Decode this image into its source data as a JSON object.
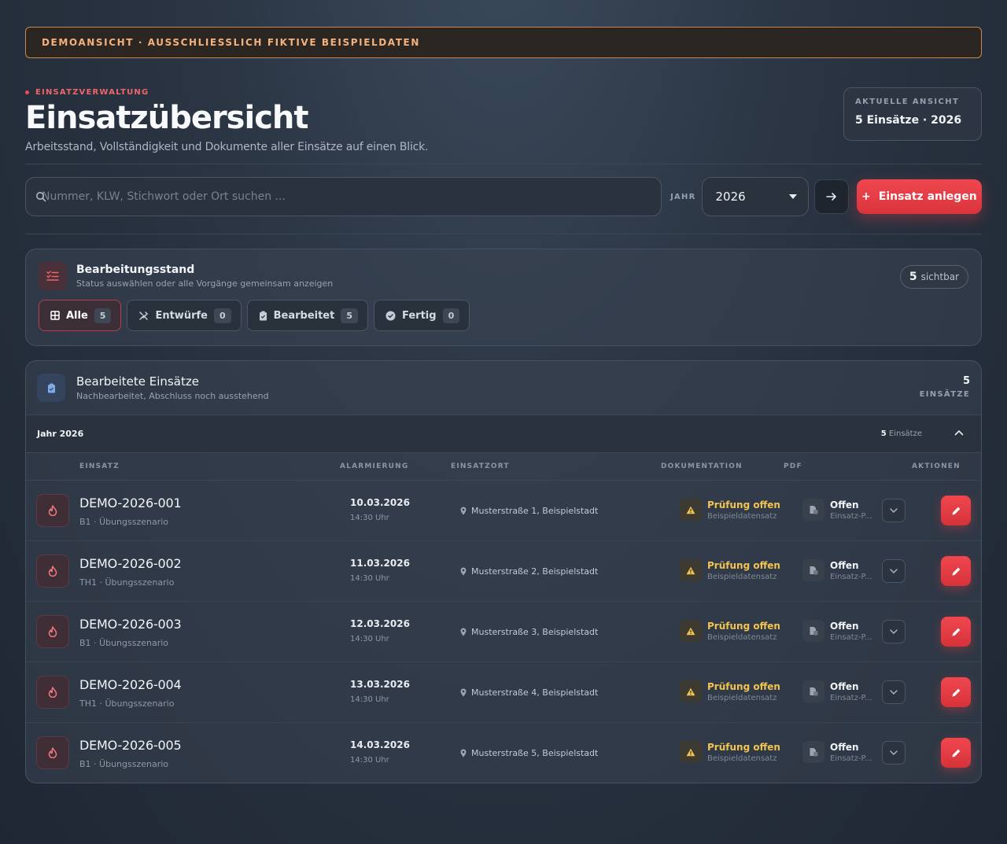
{
  "banner": "DEMOANSICHT · AUSSCHLIESSLICH FIKTIVE BEISPIELDATEN",
  "header": {
    "eyebrow": "EINSATZVERWALTUNG",
    "title": "Einsatzübersicht",
    "subtitle": "Arbeitsstand, Vollständigkeit und Dokumente aller Einsätze auf einen Blick.",
    "view_label": "AKTUELLE ANSICHT",
    "view_value": "5 Einsätze · 2026"
  },
  "toolbar": {
    "search_placeholder": "Nummer, KLW, Stichwort oder Ort suchen ...",
    "year_label": "JAHR",
    "year_value": "2026",
    "add_button": "Einsatz anlegen",
    "add_plus": "+"
  },
  "status": {
    "title": "Bearbeitungsstand",
    "subtitle": "Status auswählen oder alle Vorgänge gemeinsam anzeigen",
    "visible_count": "5",
    "visible_label": "sichtbar",
    "filters": [
      {
        "label": "Alle",
        "count": "5",
        "icon": "grid-icon"
      },
      {
        "label": "Entwürfe",
        "count": "0",
        "icon": "tools-icon"
      },
      {
        "label": "Bearbeitet",
        "count": "5",
        "icon": "clipboard-icon"
      },
      {
        "label": "Fertig",
        "count": "0",
        "icon": "check-circle-icon"
      }
    ]
  },
  "list": {
    "title": "Bearbeitete Einsätze",
    "subtitle": "Nachbearbeitet, Abschluss noch ausstehend",
    "count": "5",
    "count_unit": "EINSÄTZE",
    "year_group": "Jahr 2026",
    "year_group_count": "5",
    "year_group_unit": "Einsätze",
    "columns": [
      "EINSATZ",
      "ALARMIERUNG",
      "EINSATZORT",
      "DOKUMENTATION",
      "PDF",
      "AKTIONEN"
    ],
    "rows": [
      {
        "number": "DEMO-2026-001",
        "type": "B1 · Übungsszenario",
        "date": "10.03.2026",
        "time": "14:30 Uhr",
        "location": "Musterstraße 1, Beispielstadt",
        "doc_status": "Prüfung offen",
        "doc_sub": "Beispieldatensatz",
        "pdf_status": "Offen",
        "pdf_sub": "Einsatz-P..."
      },
      {
        "number": "DEMO-2026-002",
        "type": "TH1 · Übungsszenario",
        "date": "11.03.2026",
        "time": "14:30 Uhr",
        "location": "Musterstraße 2, Beispielstadt",
        "doc_status": "Prüfung offen",
        "doc_sub": "Beispieldatensatz",
        "pdf_status": "Offen",
        "pdf_sub": "Einsatz-P..."
      },
      {
        "number": "DEMO-2026-003",
        "type": "B1 · Übungsszenario",
        "date": "12.03.2026",
        "time": "14:30 Uhr",
        "location": "Musterstraße 3, Beispielstadt",
        "doc_status": "Prüfung offen",
        "doc_sub": "Beispieldatensatz",
        "pdf_status": "Offen",
        "pdf_sub": "Einsatz-P..."
      },
      {
        "number": "DEMO-2026-004",
        "type": "TH1 · Übungsszenario",
        "date": "13.03.2026",
        "time": "14:30 Uhr",
        "location": "Musterstraße 4, Beispielstadt",
        "doc_status": "Prüfung offen",
        "doc_sub": "Beispieldatensatz",
        "pdf_status": "Offen",
        "pdf_sub": "Einsatz-P..."
      },
      {
        "number": "DEMO-2026-005",
        "type": "B1 · Übungsszenario",
        "date": "14.03.2026",
        "time": "14:30 Uhr",
        "location": "Musterstraße 5, Beispielstadt",
        "doc_status": "Prüfung offen",
        "doc_sub": "Beispieldatensatz",
        "pdf_status": "Offen",
        "pdf_sub": "Einsatz-P..."
      }
    ]
  },
  "colors": {
    "accent": "#f0474f",
    "warning": "#f2c44f",
    "banner": "#f3b27d"
  }
}
